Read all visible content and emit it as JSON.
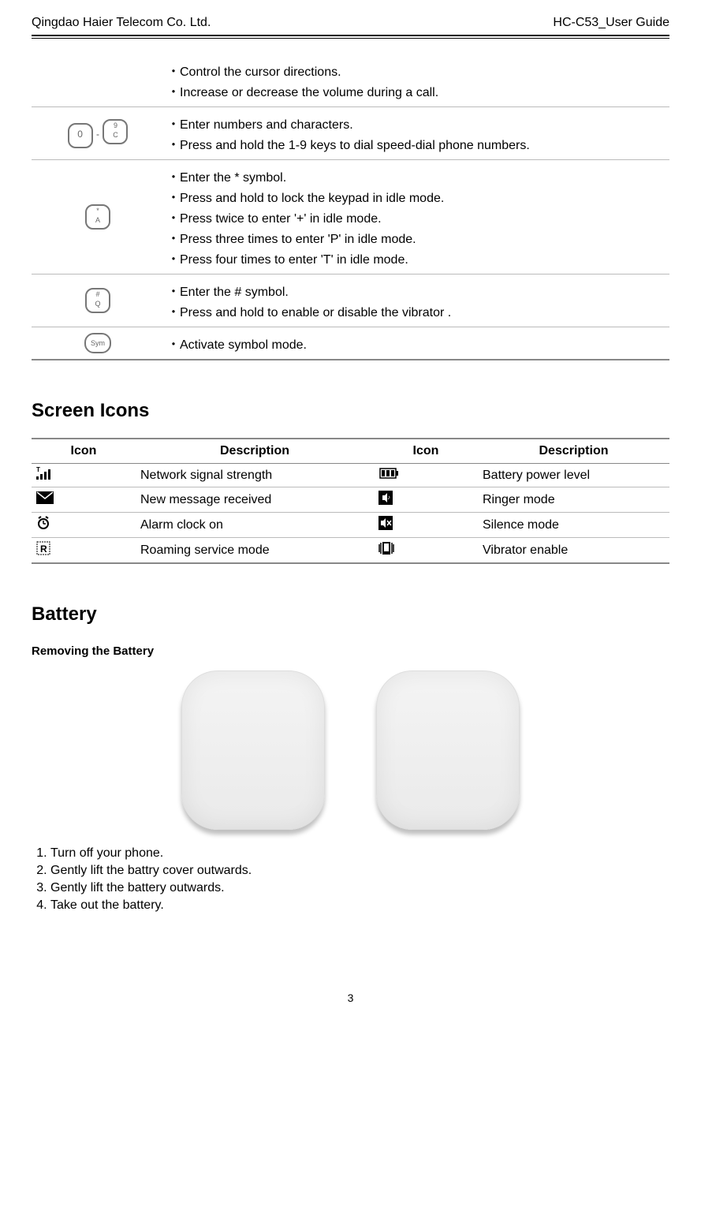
{
  "header": {
    "left": "Qingdao Haier Telecom Co. Ltd.",
    "right": "HC-C53_User Guide"
  },
  "key_rows": [
    {
      "icon_alt": "",
      "lines": [
        "・Control the cursor directions.",
        "・Increase or decrease the volume during a call."
      ]
    },
    {
      "icon_alt": "keys 0-9",
      "lines": [
        "・Enter numbers and characters.",
        "・Press and hold the 1-9 keys to dial speed-dial phone numbers."
      ]
    },
    {
      "icon_alt": "* / A key",
      "lines": [
        "・Enter the * symbol.",
        "・Press and hold to lock the keypad in idle mode.",
        "・Press twice to enter '+' in idle mode.",
        "・Press three times to enter 'P' in idle mode.",
        "・Press four times to enter 'T' in idle mode."
      ]
    },
    {
      "icon_alt": "# / Q key",
      "lines": [
        "・Enter the # symbol.",
        "・Press and hold to enable or disable the vibrator ."
      ]
    },
    {
      "icon_alt": "Sym key",
      "lines": [
        "・Activate symbol mode."
      ]
    }
  ],
  "screen_icons_heading": "Screen Icons",
  "icon_table": {
    "headers": [
      "Icon",
      "Description",
      "Icon",
      "Description"
    ],
    "rows": [
      {
        "i1": "signal-icon",
        "d1": "Network signal strength",
        "i2": "battery-icon",
        "d2": "Battery power level"
      },
      {
        "i1": "message-icon",
        "d1": "New message received",
        "i2": "ringer-icon",
        "d2": "Ringer mode"
      },
      {
        "i1": "alarm-icon",
        "d1": "Alarm clock on",
        "i2": "silence-icon",
        "d2": "Silence mode"
      },
      {
        "i1": "roaming-icon",
        "d1": "Roaming service mode",
        "i2": "vibrator-icon",
        "d2": "Vibrator enable"
      }
    ]
  },
  "battery_heading": "Battery",
  "removing_heading": "Removing the Battery",
  "steps": [
    "Turn off your phone.",
    "Gently lift    the battry cover outwards.",
    "Gently lift    the battery outwards.",
    "Take out the battery."
  ],
  "page_number": "3"
}
